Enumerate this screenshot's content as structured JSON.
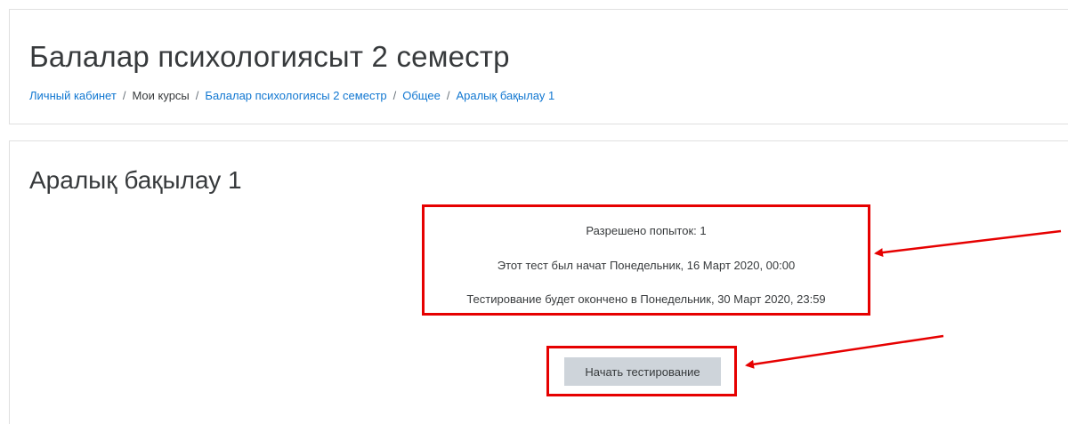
{
  "course": {
    "title": "Балалар психологиясыт 2 семестр"
  },
  "breadcrumb": {
    "items": [
      {
        "label": "Личный кабинет",
        "link": true
      },
      {
        "label": "Мои курсы",
        "link": false
      },
      {
        "label": "Балалар психологиясы 2 семестр",
        "link": true
      },
      {
        "label": "Общее",
        "link": true
      },
      {
        "label": "Аралық бақылау 1",
        "link": true
      }
    ],
    "separator": "/"
  },
  "quiz": {
    "title": "Аралық бақылау 1",
    "info": {
      "attempts_allowed": "Разрешено попыток: 1",
      "opened": "Этот тест был начат Понедельник, 16 Март 2020, 00:00",
      "closes": "Тестирование будет окончено в Понедельник, 30 Март 2020, 23:59"
    },
    "start_button_label": "Начать тестирование"
  },
  "colors": {
    "link": "#1177d1",
    "annotation": "#e60000",
    "button_bg": "#ced4da",
    "text": "#373a3c"
  }
}
